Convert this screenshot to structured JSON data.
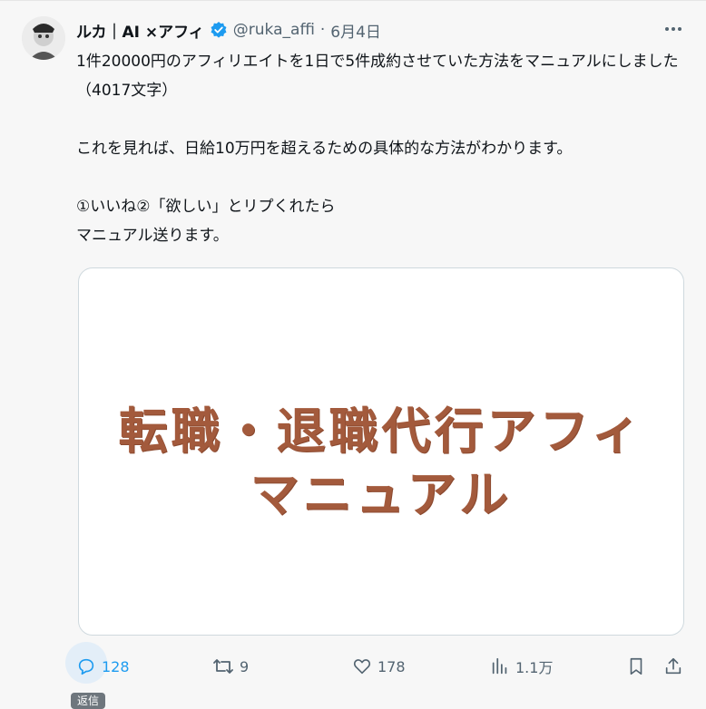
{
  "author": {
    "name": "ルカ｜AI ×アフィ",
    "handle": "@ruka_affi",
    "separator": "·",
    "date": "6月4日"
  },
  "tweet": {
    "text": "1件20000円のアフィリエイトを1日で5件成約させていた方法をマニュアルにしました（4017文字）\n\nこれを見れば、日給10万円を超えるための具体的な方法がわかります。\n\n①いいね②「欲しい」とリプくれたら\nマニュアル送ります。"
  },
  "card": {
    "line1": "転職・退職代行アフィ",
    "line2": "マニュアル"
  },
  "actions": {
    "reply_count": "128",
    "retweet_count": "9",
    "like_count": "178",
    "views_count": "1.1万",
    "tooltip": "返信"
  },
  "colors": {
    "accent": "#1d9bf0",
    "card_text": "#a35a3c",
    "muted": "#536471"
  },
  "icons": [
    "avatar",
    "verified-badge-icon",
    "more-icon",
    "reply-icon",
    "retweet-icon",
    "like-icon",
    "views-icon",
    "bookmark-icon",
    "share-icon"
  ]
}
